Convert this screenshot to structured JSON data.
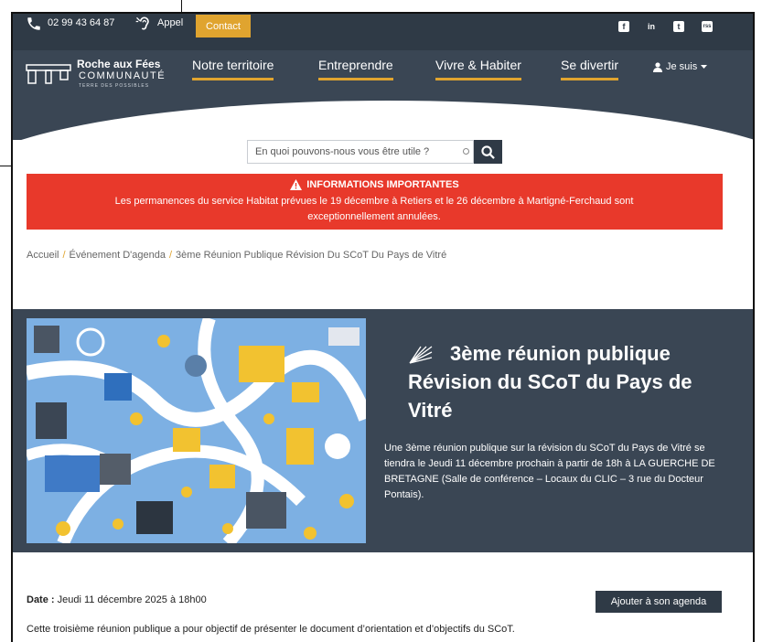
{
  "topbar": {
    "phone": "02 99 43 64 87",
    "appel": "Appel",
    "contact": "Contact",
    "social": [
      "f",
      "in",
      "t",
      "rss"
    ]
  },
  "logo": {
    "title": "Roche aux Fées",
    "subtitle": "COMMUNAUTÉ",
    "tagline": "TERRE DES POSSIBLES"
  },
  "nav": {
    "items": [
      "Notre territoire",
      "Entreprendre",
      "Vivre & Habiter",
      "Se divertir"
    ],
    "jesuis": "Je suis"
  },
  "search": {
    "placeholder": "En quoi pouvons-nous vous être utile ?"
  },
  "alert": {
    "title": "INFORMATIONS IMPORTANTES",
    "text": "Les permanences du service Habitat prévues le 19  décembre à Retiers et le 26 décembre à Martigné-Ferchaud sont exceptionnellement annulées."
  },
  "breadcrumb": [
    "Accueil",
    "Événement D'agenda",
    "3ème Réunion Publique Révision Du SCoT Du Pays de Vitré"
  ],
  "event": {
    "title": "3ème réunion publique Révision du SCoT du Pays de Vitré",
    "description": "Une 3ème réunion publique sur la révision du SCoT du Pays de Vitré se tiendra le Jeudi 11 décembre prochain à partir de 18h à LA GUERCHE DE BRETAGNE (Salle de conférence – Locaux du CLIC – 3 rue du Docteur Pontais)."
  },
  "details": {
    "date_label": "Date :",
    "date_value": "Jeudi 11 décembre 2025 à 18h00",
    "agenda_button": "Ajouter à son agenda",
    "intro": "Cette troisième réunion publique a pour objectif de présenter le document d’orientation et d’objectifs du SCoT."
  },
  "colors": {
    "dark": "#2f3a46",
    "header": "#3a4654",
    "accent": "#e0a42f",
    "alert": "#e8392b"
  }
}
